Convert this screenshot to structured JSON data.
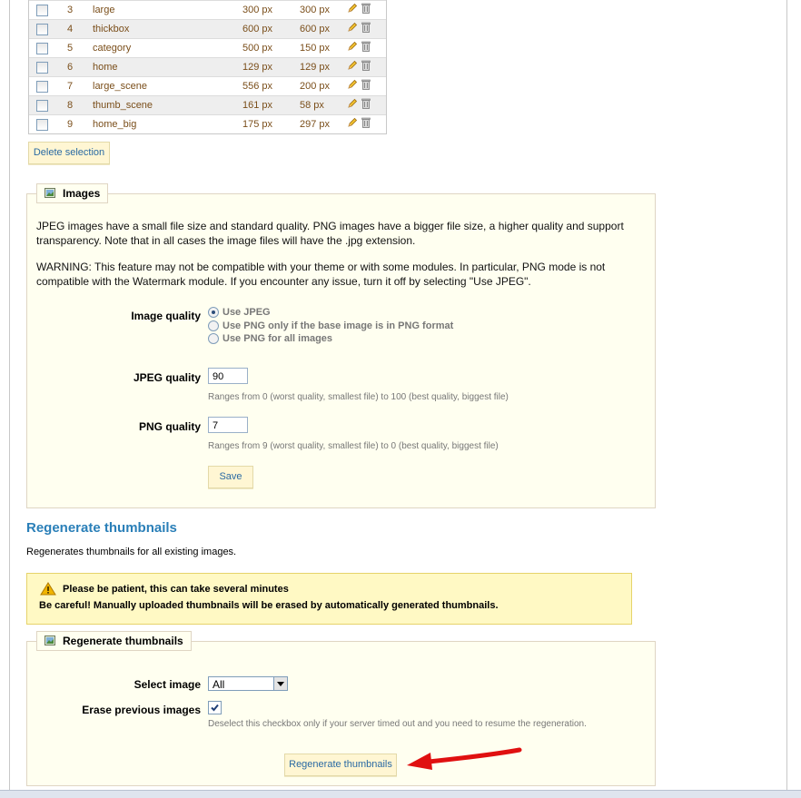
{
  "table": {
    "rows": [
      {
        "id": "3",
        "name": "large",
        "width": "300 px",
        "height": "300 px"
      },
      {
        "id": "4",
        "name": "thickbox",
        "width": "600 px",
        "height": "600 px"
      },
      {
        "id": "5",
        "name": "category",
        "width": "500 px",
        "height": "150 px"
      },
      {
        "id": "6",
        "name": "home",
        "width": "129 px",
        "height": "129 px"
      },
      {
        "id": "7",
        "name": "large_scene",
        "width": "556 px",
        "height": "200 px"
      },
      {
        "id": "8",
        "name": "thumb_scene",
        "width": "161 px",
        "height": "58 px"
      },
      {
        "id": "9",
        "name": "home_big",
        "width": "175 px",
        "height": "297 px"
      }
    ],
    "delete_selection_label": "Delete selection"
  },
  "images_box": {
    "legend": "Images",
    "intro": "JPEG images have a small file size and standard quality. PNG images have a bigger file size, a higher quality and support transparency. Note that in all cases the image files will have the .jpg extension.",
    "warning": "WARNING: This feature may not be compatible with your theme or with some modules. In particular, PNG mode is not compatible with the Watermark module. If you encounter any issue, turn it off by selecting \"Use JPEG\".",
    "image_quality_label": "Image quality",
    "options": [
      "Use JPEG",
      "Use PNG only if the base image is in PNG format",
      "Use PNG for all images"
    ],
    "selected_option": "Use JPEG",
    "jpeg_quality_label": "JPEG quality",
    "jpeg_quality_value": "90",
    "jpeg_hint": "Ranges from 0 (worst quality, smallest file) to 100 (best quality, biggest file)",
    "png_quality_label": "PNG quality",
    "png_quality_value": "7",
    "png_hint": "Ranges from 9 (worst quality, smallest file) to 0 (best quality, biggest file)",
    "save_label": "Save"
  },
  "regenerate_section": {
    "heading": "Regenerate thumbnails",
    "description": "Regenerates thumbnails for all existing images.",
    "alert_title": "Please be patient, this can take several minutes",
    "alert_body": "Be careful! Manually uploaded thumbnails will be erased by automatically generated thumbnails."
  },
  "regenerate_box": {
    "legend": "Regenerate thumbnails",
    "select_image_label": "Select image",
    "select_image_value": "All",
    "erase_label": "Erase previous images",
    "erase_checked": true,
    "erase_hint": "Deselect this checkbox only if your server timed out and you need to resume the regeneration.",
    "button_label": "Regenerate thumbnails"
  },
  "colors": {
    "heading_blue": "#2a7fb8",
    "panel_bg": "#fffff0",
    "alert_bg": "#fff9c4",
    "arrow_red": "#e01010"
  }
}
